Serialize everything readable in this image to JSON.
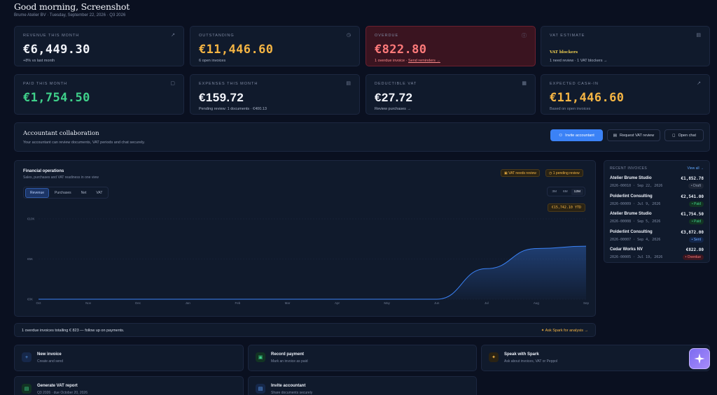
{
  "header": {
    "greeting": "Good morning, Screenshot",
    "subline": "Brume Atelier BV · Tuesday, September 22, 2026 · Q3 2026"
  },
  "kpis": {
    "revenue": {
      "label": "REVENUE THIS MONTH",
      "value": "€6,449.30",
      "sub": "+8% vs last month",
      "icon": "trend-up-icon"
    },
    "outstanding": {
      "label": "OUTSTANDING",
      "value": "€11,446.60",
      "sub": "6 open invoices",
      "icon": "clock-icon"
    },
    "overdue": {
      "label": "OVERDUE",
      "value": "€822.80",
      "sub": "1 overdue invoice ·",
      "link": "Send reminders →",
      "icon": "alert-icon"
    },
    "vat": {
      "label": "VAT ESTIMATE",
      "badge": "VAT blockers",
      "sub": "1 need review · 1 VAT blockers →",
      "icon": "document-icon"
    },
    "paid": {
      "label": "PAID THIS MONTH",
      "value": "€1,754.50",
      "icon": "receipt-icon"
    },
    "expenses": {
      "label": "EXPENSES THIS MONTH",
      "value": "€159.72",
      "sub": "Pending review: 1 documents · €400.13",
      "icon": "file-icon"
    },
    "deductible": {
      "label": "DEDUCTIBLE VAT",
      "value": "€27.72",
      "sub": "Review purchases →",
      "icon": "calc-icon"
    },
    "cashin": {
      "label": "EXPECTED CASH-IN",
      "value": "€11,446.60",
      "sub": "Based on open invoices",
      "icon": "trend-up-icon"
    }
  },
  "collab": {
    "title": "Accountant collaboration",
    "desc": "Your accountant can review documents, VAT periods and chat securely.",
    "invite": "Invite accountant",
    "request": "Request VAT review",
    "chat": "Open chat"
  },
  "ops": {
    "title": "Financial operations",
    "desc": "Sales, purchases and VAT readiness in one view",
    "pill_vat": "VAT needs review",
    "pill_pending": "1 pending review",
    "tabs": [
      "Revenue",
      "Purchases",
      "Net",
      "VAT"
    ],
    "active_tab": "Revenue",
    "ranges": [
      "3M",
      "6M",
      "12M"
    ],
    "active_range": "12M",
    "ytd": "€15,742.10 YTD"
  },
  "chart_data": {
    "type": "area",
    "x": [
      "Oct",
      "Nov",
      "Dec",
      "Jan",
      "Feb",
      "Mar",
      "Apr",
      "May",
      "Jun",
      "Jul",
      "Aug",
      "Sep"
    ],
    "y_ticks": [
      "€10K",
      "€5K",
      "€0K"
    ],
    "ylim": [
      0,
      10000
    ],
    "series": [
      {
        "values": [
          0,
          0,
          0,
          0,
          0,
          0,
          0,
          0,
          0,
          3800,
          6300,
          6600
        ]
      }
    ],
    "grid": true,
    "color": "#3b82f6"
  },
  "recent": {
    "header": "RECENT INVOICES",
    "view_all": "View all →",
    "items": [
      {
        "client": "Atelier Brume Studio",
        "meta": "2026-00010 · Sep 22, 2026",
        "amount": "€1,852.78",
        "status": "• Draft",
        "kind": "draft"
      },
      {
        "client": "Polderlint Consulting",
        "meta": "2026-00009 · Jul 9, 2026",
        "amount": "€2,541.00",
        "status": "• Paid",
        "kind": "paid"
      },
      {
        "client": "Atelier Brume Studio",
        "meta": "2026-00008 · Sep 5, 2026",
        "amount": "€1,754.50",
        "status": "• Paid",
        "kind": "paid"
      },
      {
        "client": "Polderlint Consulting",
        "meta": "2026-00007 · Sep 4, 2026",
        "amount": "€3,872.00",
        "status": "• Sent",
        "kind": "sent"
      },
      {
        "client": "Cedar Works NV",
        "meta": "2026-00005 · Jul 19, 2026",
        "amount": "€822.80",
        "status": "• Overdue",
        "kind": "overdue"
      }
    ]
  },
  "alert": {
    "text": "1 overdue invoices totalling € 823 — follow up on payments.",
    "action": "Ask Spark for analysis →"
  },
  "actions": [
    {
      "name": "New invoice",
      "desc": "Create and send",
      "icon": "plus-icon",
      "color": "#60a5fa",
      "bg": "#16284a"
    },
    {
      "name": "Record payment",
      "desc": "Mark an invoice as paid",
      "icon": "wallet-icon",
      "color": "#3fd08a",
      "bg": "#123423"
    },
    {
      "name": "Speak with Spark",
      "desc": "Ask about invoices, VAT or Peppol",
      "icon": "sparkle-icon",
      "color": "#f5b544",
      "bg": "#2a2314"
    },
    {
      "name": "Generate VAT report",
      "desc": "Q3 2026 · due October 20, 2026",
      "icon": "report-icon",
      "color": "#3fd08a",
      "bg": "#123423"
    },
    {
      "name": "Invite accountant",
      "desc": "Share documents securely",
      "icon": "user-icon",
      "color": "#60a5fa",
      "bg": "#16284a"
    }
  ]
}
